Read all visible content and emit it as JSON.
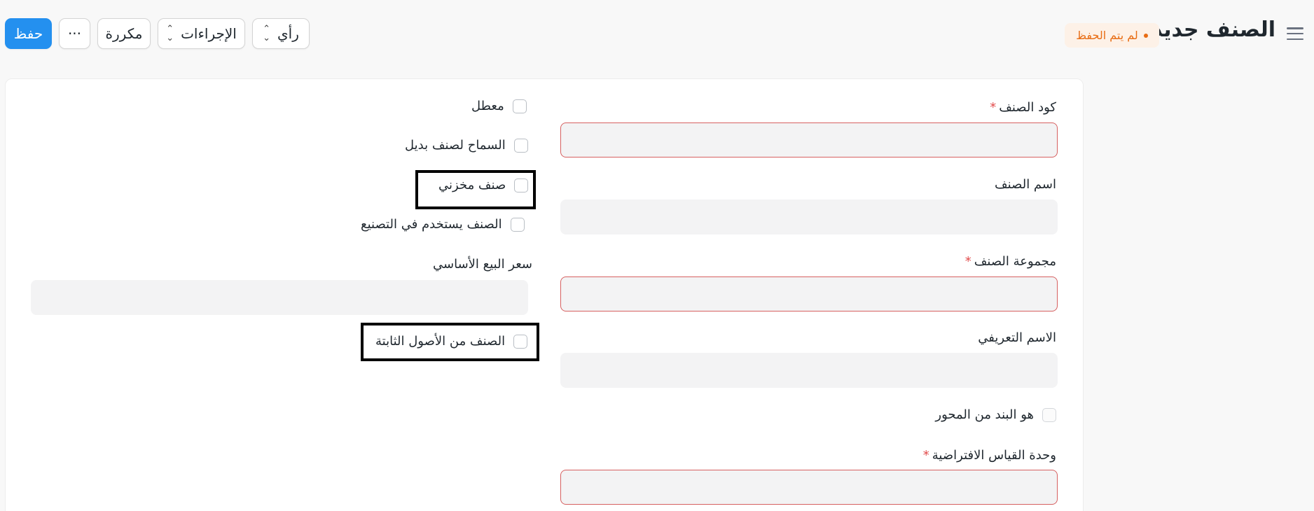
{
  "header": {
    "title": "الصنف جديد",
    "status": "لم يتم الحفظ",
    "buttons": {
      "save": "حفظ",
      "more": "···",
      "duplicate": "مكررة",
      "actions": "الإجراءات",
      "view": "رأي"
    },
    "icons": {
      "menu": "hamburger-icon",
      "updown": "updown-chevron-icon"
    }
  },
  "form": {
    "right_column": {
      "item_code": {
        "label": "كود الصنف",
        "required": true,
        "value": ""
      },
      "item_name": {
        "label": "اسم الصنف",
        "required": false,
        "value": ""
      },
      "item_group": {
        "label": "مجموعة الصنف",
        "required": true,
        "value": ""
      },
      "description_name": {
        "label": "الاسم التعريفي",
        "required": false,
        "value": ""
      },
      "is_pivot_item": {
        "label": "هو البند من المحور",
        "checked": false
      },
      "default_uom": {
        "label": "وحدة القياس الافتراضية",
        "required": true,
        "value": ""
      }
    },
    "left_column": {
      "disabled": {
        "label": "معطل",
        "checked": false
      },
      "allow_alternative": {
        "label": "السماح لصنف بديل",
        "checked": false
      },
      "stock_item": {
        "label": "صنف مخزني",
        "checked": false
      },
      "manufacturing_item": {
        "label": "الصنف يستخدم في التصنيع",
        "checked": false
      },
      "standard_rate": {
        "label": "سعر البيع الأساسي",
        "value": ""
      },
      "fixed_asset": {
        "label": "الصنف من الأصول الثابتة",
        "checked": false
      }
    },
    "required_marker": "*"
  },
  "colors": {
    "primary": "#2490ef",
    "status": "#e86c13",
    "required": "#e24c4c",
    "highlight": "#000000"
  }
}
